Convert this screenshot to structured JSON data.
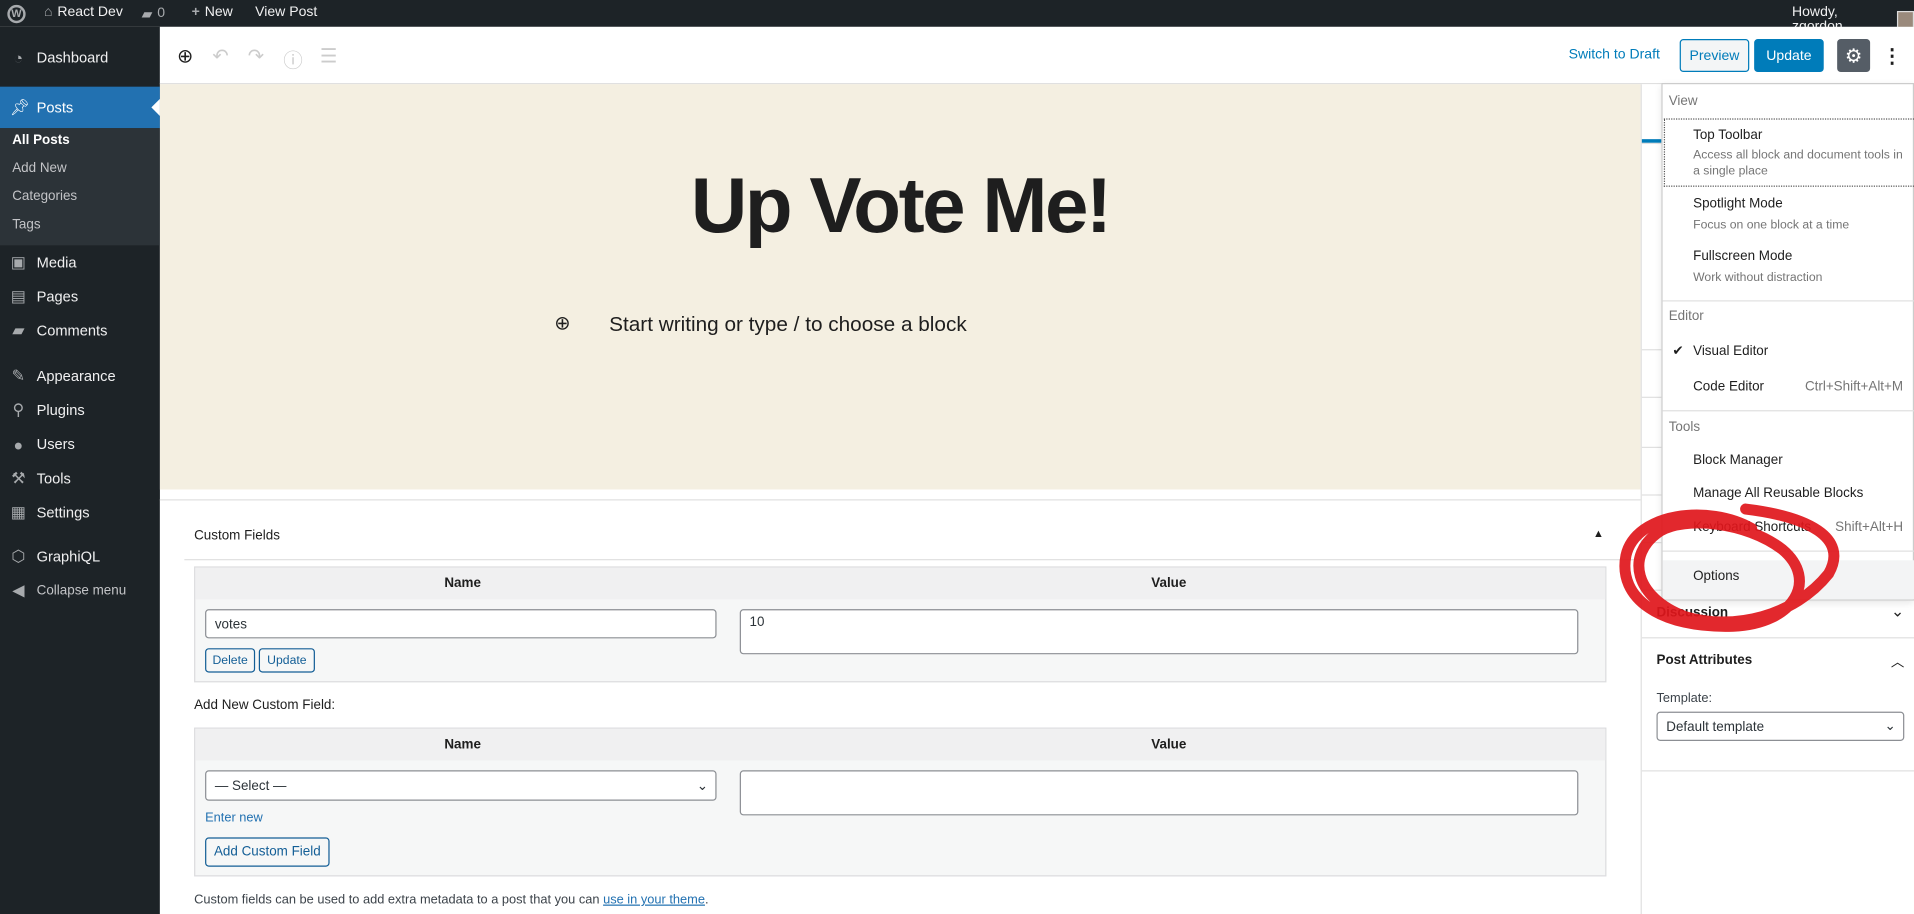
{
  "admin_bar": {
    "site": "React Dev",
    "comments": "0",
    "new": "New",
    "view_post": "View Post",
    "howdy": "Howdy, zgordon"
  },
  "sidebar": {
    "items": [
      {
        "label": "Dashboard",
        "icon": "dashboard-icon"
      },
      {
        "label": "Posts",
        "icon": "pin-icon"
      },
      {
        "label": "Media",
        "icon": "media-icon"
      },
      {
        "label": "Pages",
        "icon": "pages-icon"
      },
      {
        "label": "Comments",
        "icon": "comments-icon"
      },
      {
        "label": "Appearance",
        "icon": "brush-icon"
      },
      {
        "label": "Plugins",
        "icon": "plugin-icon"
      },
      {
        "label": "Users",
        "icon": "user-icon"
      },
      {
        "label": "Tools",
        "icon": "wrench-icon"
      },
      {
        "label": "Settings",
        "icon": "settings-icon"
      },
      {
        "label": "GraphiQL",
        "icon": "graphql-icon"
      },
      {
        "label": "Collapse menu",
        "icon": "collapse-icon"
      }
    ],
    "posts_sub": [
      "All Posts",
      "Add New",
      "Categories",
      "Tags"
    ]
  },
  "toolbar": {
    "switch_draft": "Switch to Draft",
    "preview": "Preview",
    "update": "Update"
  },
  "editor": {
    "title": "Up Vote Me!",
    "placeholder": "Start writing or type / to choose a block",
    "bg": "#f4efe1"
  },
  "custom_fields": {
    "title": "Custom Fields",
    "name_header": "Name",
    "value_header": "Value",
    "rows": [
      {
        "name": "votes",
        "value": "10"
      }
    ],
    "delete": "Delete",
    "update": "Update",
    "add_new_label": "Add New Custom Field:",
    "select": "— Select —",
    "enter_new": "Enter new",
    "add_button": "Add Custom Field",
    "help": "Custom fields can be used to add extra metadata to a post that you can ",
    "help_link": "use in your theme",
    "help_end": "."
  },
  "settings": {
    "discussion": "Discussion",
    "post_attributes": "Post Attributes",
    "template_label": "Template:",
    "template_value": "Default template"
  },
  "menu": {
    "view": "View",
    "top_toolbar": "Top Toolbar",
    "top_toolbar_desc": "Access all block and document tools in a single place",
    "spotlight": "Spotlight Mode",
    "spotlight_desc": "Focus on one block at a time",
    "fullscreen": "Fullscreen Mode",
    "fullscreen_desc": "Work without distraction",
    "editor": "Editor",
    "visual": "Visual Editor",
    "code": "Code Editor",
    "code_shortcut": "Ctrl+Shift+Alt+M",
    "tools": "Tools",
    "block_manager": "Block Manager",
    "reusable": "Manage All Reusable Blocks",
    "shortcuts": "Keyboard Shortcuts",
    "shortcuts_key": "Shift+Alt+H",
    "options": "Options"
  },
  "colors": {
    "accent": "#007cba",
    "admin_dark": "#1d2327",
    "annotation": "#e0161b"
  }
}
